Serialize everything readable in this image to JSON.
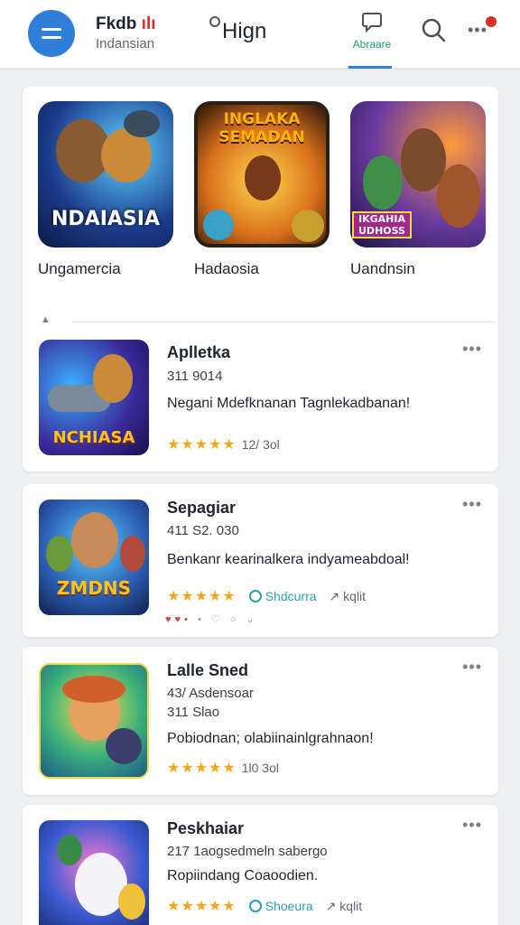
{
  "header": {
    "brand_title": "Fkdb",
    "brand_accent": "ılı",
    "brand_subtitle": "Indansian",
    "center_title": "Hign",
    "active_tab_label": "Abraare",
    "icons": [
      "menu-icon",
      "chat-bubble-icon",
      "search-icon",
      "more-dots-icon"
    ]
  },
  "featured": {
    "items": [
      {
        "name": "Ungamercia",
        "logo": "NDAIASIA"
      },
      {
        "name": "Hadaosia",
        "logo": "INGLAKA\nSEMADAN"
      },
      {
        "name": "Uandnsin",
        "logo": "IKGAHIA\nUDHOSS"
      }
    ]
  },
  "apps": [
    {
      "title": "Aplletka",
      "meta": "311  9014",
      "desc": "Negani Mdefknanan Tagnlekadbanan!",
      "rating_text": "12/ 3ol",
      "logo": "NCHIASA"
    },
    {
      "title": "Sepagiar",
      "meta": "411  S2. 030",
      "desc": "Benkanr kearinalkera indyameabdoal!",
      "share_label": "Shdcurra",
      "kplt_label": "kqlit",
      "logo": "ZMDNS"
    },
    {
      "title": "Lalle Sned",
      "meta": "43/ Asdensoar",
      "meta2": "311  Slao",
      "desc": "Pobiodnan; olabiinainlgrahnaon!",
      "rating_text": "1l0  3ol"
    },
    {
      "title": "Peskhaiar",
      "meta": "217  1aogsedmeln sabergo",
      "desc": "Ropiindang Coaoodien.",
      "share_label": "Shoeura",
      "kplt_label": "kqlit"
    }
  ],
  "colors": {
    "accent_blue": "#2f7fd8",
    "accent_green": "#1aa06d",
    "accent_red": "#d93025",
    "star": "#f0a91c",
    "share_teal": "#2a9fb3"
  }
}
